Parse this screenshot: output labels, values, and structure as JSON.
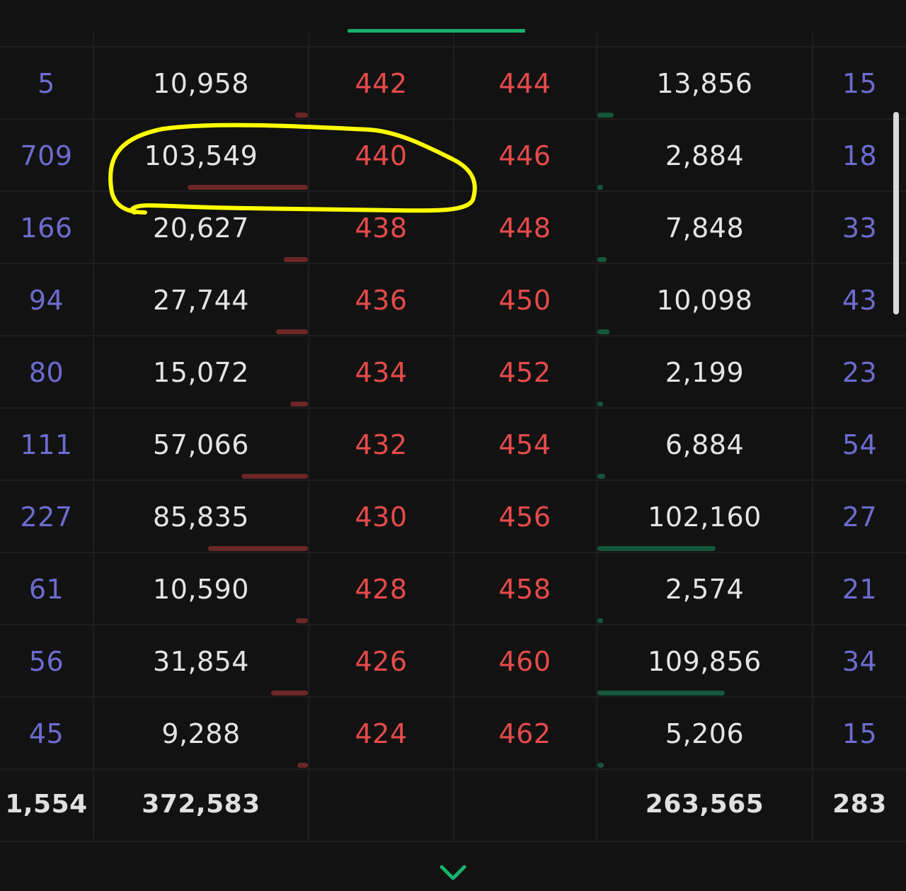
{
  "colors": {
    "background": "#121212",
    "count": "#6d6cd0",
    "volume": "#e4e4e4",
    "price": "#e64b4b",
    "bid_bar": "#6b2626",
    "ask_bar": "#14573c",
    "accent": "#18b16a",
    "annotation": "#ffff00"
  },
  "rows": [
    {
      "bid_count": "5",
      "bid_volume": "10,958",
      "bid_price": "442",
      "ask_price": "444",
      "ask_volume": "13,856",
      "ask_count": "15"
    },
    {
      "bid_count": "709",
      "bid_volume": "103,549",
      "bid_price": "440",
      "ask_price": "446",
      "ask_volume": "2,884",
      "ask_count": "18"
    },
    {
      "bid_count": "166",
      "bid_volume": "20,627",
      "bid_price": "438",
      "ask_price": "448",
      "ask_volume": "7,848",
      "ask_count": "33"
    },
    {
      "bid_count": "94",
      "bid_volume": "27,744",
      "bid_price": "436",
      "ask_price": "450",
      "ask_volume": "10,098",
      "ask_count": "43"
    },
    {
      "bid_count": "80",
      "bid_volume": "15,072",
      "bid_price": "434",
      "ask_price": "452",
      "ask_volume": "2,199",
      "ask_count": "23"
    },
    {
      "bid_count": "111",
      "bid_volume": "57,066",
      "bid_price": "432",
      "ask_price": "454",
      "ask_volume": "6,884",
      "ask_count": "54"
    },
    {
      "bid_count": "227",
      "bid_volume": "85,835",
      "bid_price": "430",
      "ask_price": "456",
      "ask_volume": "102,160",
      "ask_count": "27"
    },
    {
      "bid_count": "61",
      "bid_volume": "10,590",
      "bid_price": "428",
      "ask_price": "458",
      "ask_volume": "2,574",
      "ask_count": "21"
    },
    {
      "bid_count": "56",
      "bid_volume": "31,854",
      "bid_price": "426",
      "ask_price": "460",
      "ask_volume": "109,856",
      "ask_count": "34"
    },
    {
      "bid_count": "45",
      "bid_volume": "9,288",
      "bid_price": "424",
      "ask_price": "462",
      "ask_volume": "5,206",
      "ask_count": "15"
    }
  ],
  "totals": {
    "bid_count": "1,554",
    "bid_volume": "372,583",
    "ask_volume": "263,565",
    "ask_count": "283"
  },
  "icons": {
    "expand": "chevron-down-icon"
  }
}
